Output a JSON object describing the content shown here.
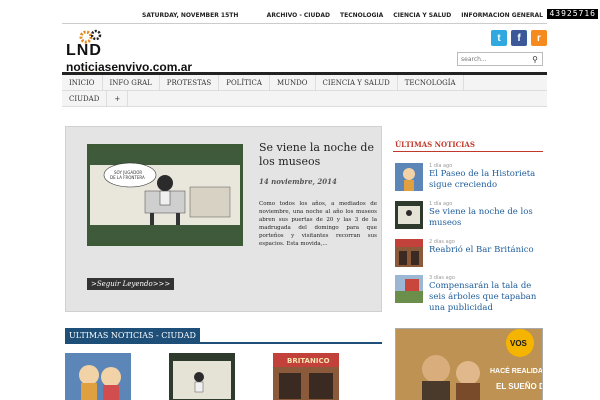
{
  "counter": "43925716",
  "header": {
    "date_day": "SATURDAY",
    "date_rest": ", NOVEMBER 15TH",
    "top_links": [
      "ARCHIVO - CIUDAD",
      "TECNOLOGIA",
      "CIENCIA Y SALUD",
      "INFORMACION GENERAL"
    ]
  },
  "logo": {
    "letters": "LND",
    "site": "noticiasenvivo.com.ar",
    "site_shadow": "noticiasenvivo.com.ar"
  },
  "social": {
    "twitter": "t",
    "facebook": "f",
    "rss": "r"
  },
  "search": {
    "placeholder": "search..."
  },
  "nav": {
    "row1": [
      "INICIO",
      "INFO GRAL",
      "PROTESTAS",
      "POLÍTICA",
      "MUNDO",
      "CIENCIA Y SALUD",
      "TECNOLOGÍA"
    ],
    "row2": [
      "CIUDAD",
      "+"
    ]
  },
  "feature": {
    "title": "Se viene la noche de los museos",
    "date": "14 noviembre, 2014",
    "excerpt": "Como todos los años, a mediados de noviembre, una noche al año los museos abren sus puertas de 20 y las 3 de la madrugada del domingo para que porteños y visitantes recorran sus espacios. Esta movida,...",
    "more": ">Seguir Leyendo>>>",
    "img_caption": "SOY JUGADOR DE LA FRONTERA ANAGONICA"
  },
  "section": {
    "label": "ULTIMAS NOTICIAS - CIUDAD"
  },
  "sidebar": {
    "heading": "ÚLTIMAS NOTICIAS",
    "items": [
      {
        "ago": "1 día ago",
        "title": "El Paseo de la Historieta sigue creciendo"
      },
      {
        "ago": "1 día ago",
        "title": "Se viene la noche de los museos"
      },
      {
        "ago": "2 días ago",
        "title": "Reabrió el Bar Británico"
      },
      {
        "ago": "3 días ago",
        "title": "Compensarán la tala de seis árboles que tapaban una publicidad"
      }
    ]
  },
  "ad": {
    "brand": "VOS",
    "text1": "HACÉ REALIDAD",
    "text2": "EL SUEÑO DE"
  },
  "thumbs": {
    "bar_sign": "BRITANICO"
  }
}
